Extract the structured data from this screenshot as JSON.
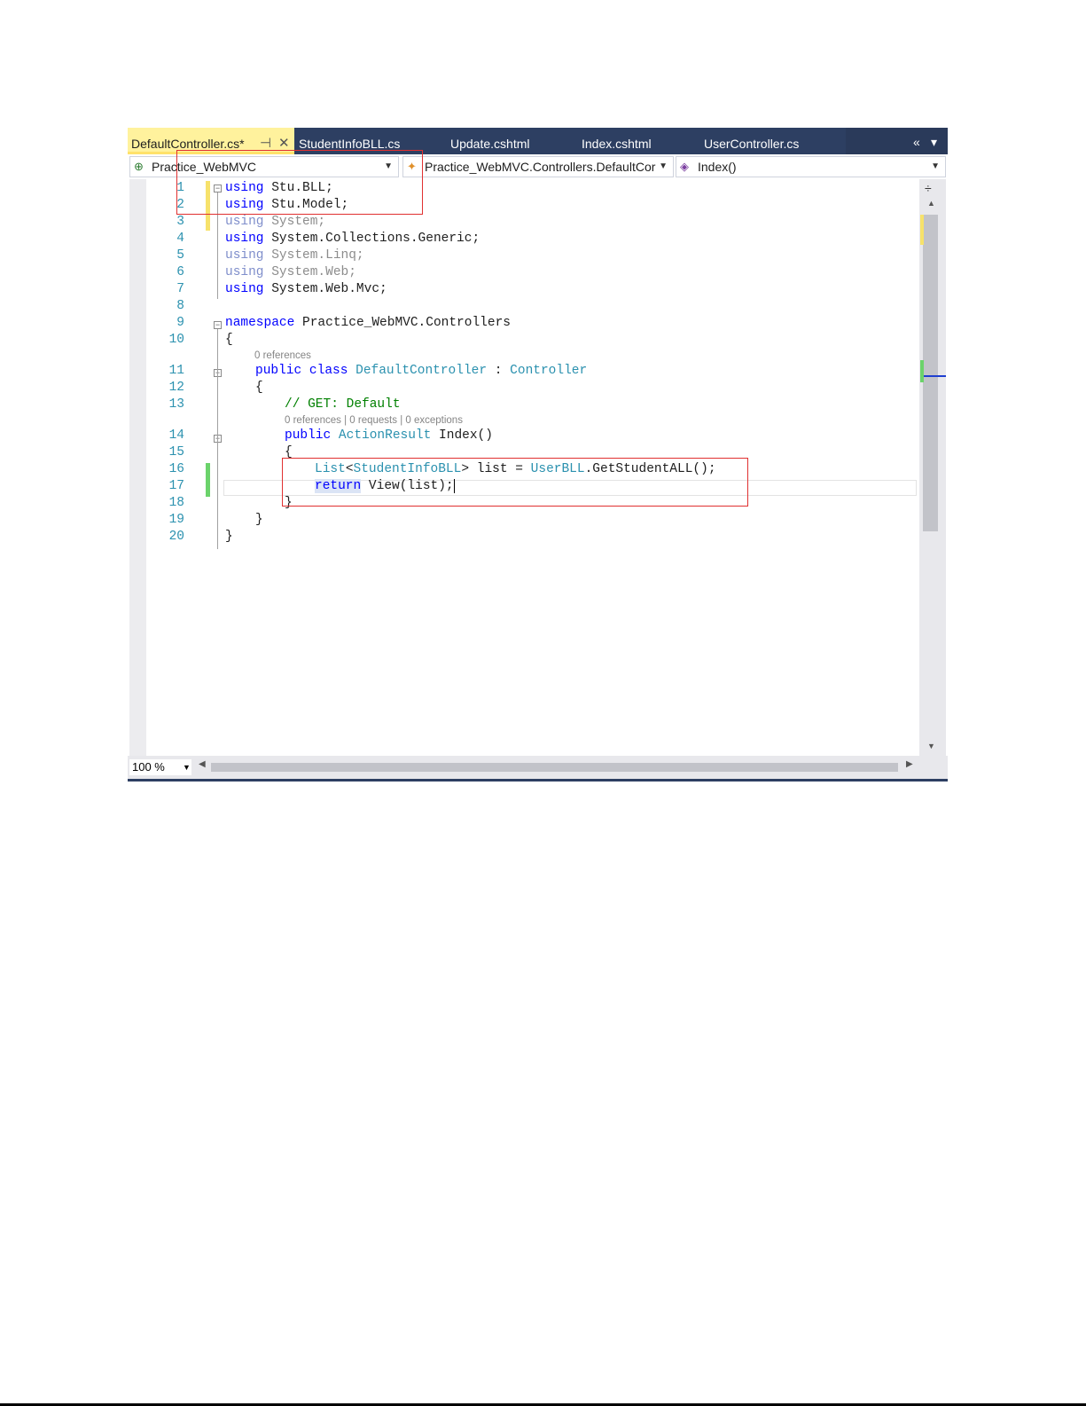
{
  "tabs": [
    {
      "label": "DefaultController.cs*",
      "active": true
    },
    {
      "label": "StudentInfoBLL.cs",
      "active": false
    },
    {
      "label": "Update.cshtml",
      "active": false
    },
    {
      "label": "Index.cshtml",
      "active": false
    },
    {
      "label": "UserController.cs",
      "active": false
    }
  ],
  "tab_controls": {
    "pin": "⊣",
    "close": "✕",
    "overflow": "«",
    "menu": "▾"
  },
  "navbar": {
    "project": "Practice_WebMVC",
    "type": "Practice_WebMVC.Controllers.DefaultCor",
    "member": "Index()"
  },
  "code": {
    "line_numbers": [
      "1",
      "2",
      "3",
      "4",
      "5",
      "6",
      "7",
      "8",
      "9",
      "10",
      "11",
      "12",
      "13",
      "14",
      "15",
      "16",
      "17",
      "18",
      "19",
      "20"
    ],
    "lines": {
      "l1_kw": "using",
      "l1_rest": " Stu.BLL;",
      "l2_kw": "using",
      "l2_rest": " Stu.Model;",
      "l3_kw": "using",
      "l3_rest": " System;",
      "l4_kw": "using",
      "l4_rest": " System.Collections.Generic;",
      "l5_kw": "using",
      "l5_rest": " System.Linq;",
      "l6_kw": "using",
      "l6_rest": " System.Web;",
      "l7_kw": "using",
      "l7_rest": " System.Web.Mvc;",
      "l9_kw": "namespace",
      "l9_rest": " Practice_WebMVC.Controllers",
      "l10": "{",
      "l11_kw": "public class",
      "l11_type": "DefaultController",
      "l11_colon": " : ",
      "l11_base": "Controller",
      "l12": "{",
      "l13_comment": "// GET: Default",
      "l14_kw": "public",
      "l14_type": "ActionResult",
      "l14_rest": " Index()",
      "l15": "{",
      "l16_list": "List",
      "l16_lt": "<",
      "l16_type": "StudentInfoBLL",
      "l16_mid": "> list = ",
      "l16_cls": "UserBLL",
      "l16_rest": ".GetStudentALL();",
      "l17_kw": "return",
      "l17_rest": " View(list);",
      "l18": "}",
      "l19": "}",
      "l20": "}"
    },
    "codelens_class": "0 references",
    "codelens_method": "0 references | 0 requests | 0 exceptions"
  },
  "zoom_level": "100 %"
}
